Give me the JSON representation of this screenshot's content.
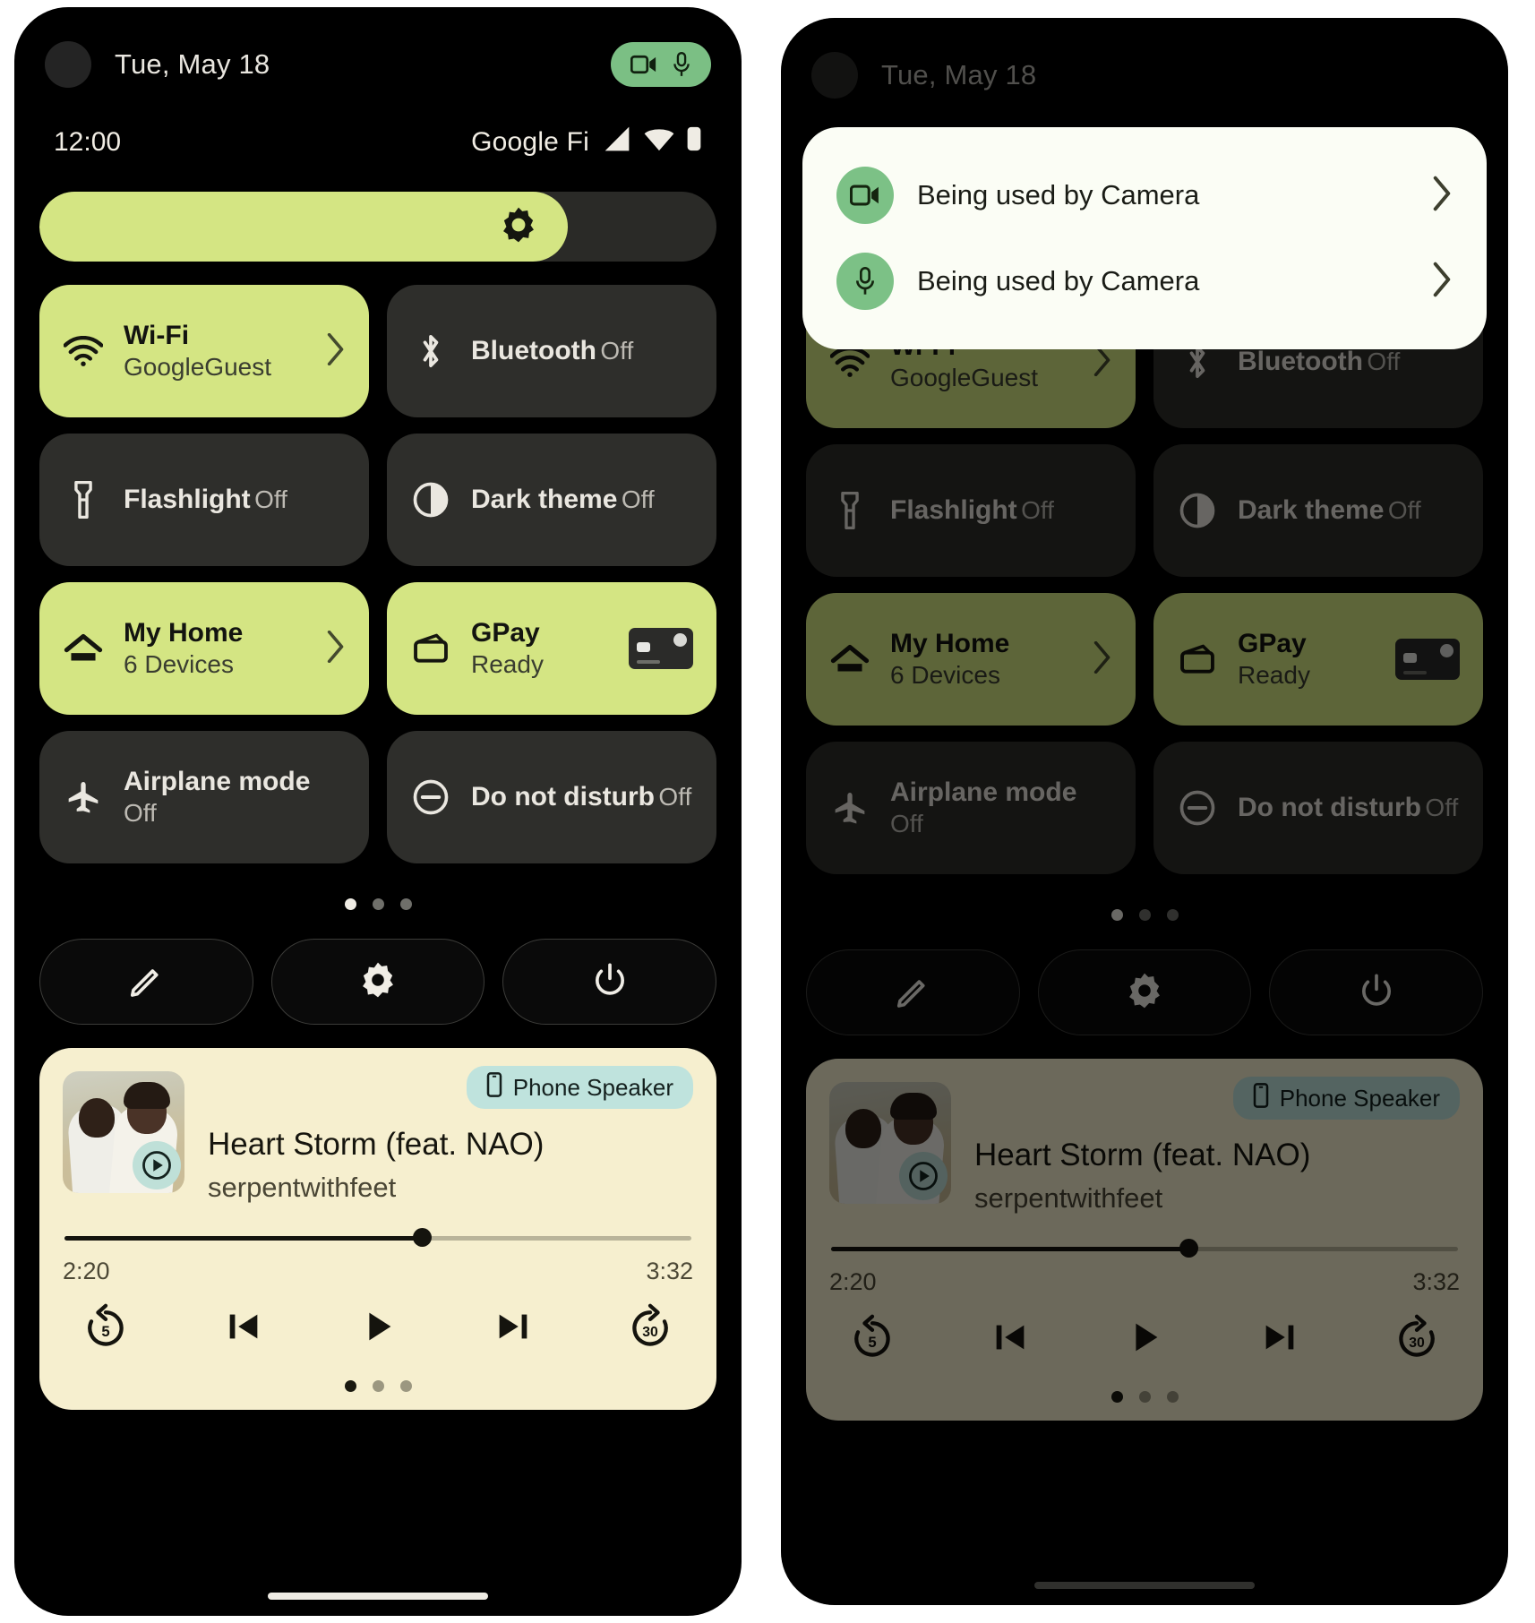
{
  "colors": {
    "accent_active_tile": "#d4e583",
    "tile_inactive": "#2e2e2b",
    "privacy_green": "#7bbf84",
    "media_bg": "#f6efcf",
    "speaker_chip": "#bfe3dd",
    "screen_bg": "#000000"
  },
  "status": {
    "date": "Tue, May 18",
    "time": "12:00",
    "carrier": "Google Fi",
    "privacy_icons": [
      "camera-icon",
      "microphone-icon"
    ],
    "signal_icon": "cell-signal-icon",
    "wifi_icon": "wifi-icon",
    "battery_icon": "battery-icon"
  },
  "brightness": {
    "icon": "brightness-icon",
    "level_percent": 78
  },
  "tiles": [
    {
      "name": "Wi-Fi",
      "sub": "GoogleGuest",
      "icon": "wifi-icon",
      "active": true,
      "chevron": true,
      "thumb": false
    },
    {
      "name": "Bluetooth",
      "sub": "Off",
      "icon": "bluetooth-icon",
      "active": false,
      "chevron": false,
      "thumb": false
    },
    {
      "name": "Flashlight",
      "sub": "Off",
      "icon": "flashlight-icon",
      "active": false,
      "chevron": false,
      "thumb": false
    },
    {
      "name": "Dark theme",
      "sub": "Off",
      "icon": "dark-theme-icon",
      "active": false,
      "chevron": false,
      "thumb": false
    },
    {
      "name": "My Home",
      "sub": "6 Devices",
      "icon": "home-icon",
      "active": true,
      "chevron": true,
      "thumb": false
    },
    {
      "name": "GPay",
      "sub": "Ready",
      "icon": "wallet-icon",
      "active": true,
      "chevron": false,
      "thumb": true
    },
    {
      "name": "Airplane mode",
      "sub": "Off",
      "icon": "airplane-icon",
      "active": false,
      "chevron": false,
      "thumb": false
    },
    {
      "name": "Do not disturb",
      "sub": "Off",
      "icon": "do-not-disturb-icon",
      "active": false,
      "chevron": false,
      "thumb": false
    }
  ],
  "pager": {
    "count": 3,
    "active_index": 0
  },
  "footer_actions": [
    {
      "name": "edit-tiles",
      "icon": "pencil-icon"
    },
    {
      "name": "settings",
      "icon": "gear-icon"
    },
    {
      "name": "power",
      "icon": "power-icon"
    }
  ],
  "media": {
    "output_label": "Phone Speaker",
    "output_icon": "phone-icon",
    "title": "Heart Storm (feat. NAO)",
    "artist": "serpentwithfeet",
    "elapsed": "2:20",
    "duration": "3:32",
    "progress_percent": 57,
    "art_badge_icon": "play-circle-icon",
    "controls": [
      {
        "name": "rewind-5-button",
        "icon": "replay-5-icon",
        "label": "5"
      },
      {
        "name": "previous-button",
        "icon": "skip-previous-icon",
        "label": ""
      },
      {
        "name": "play-button",
        "icon": "play-icon",
        "label": ""
      },
      {
        "name": "next-button",
        "icon": "skip-next-icon",
        "label": ""
      },
      {
        "name": "forward-30-button",
        "icon": "forward-30-icon",
        "label": "30"
      }
    ],
    "pager": {
      "count": 3,
      "active_index": 0
    }
  },
  "privacy_dialog": {
    "rows": [
      {
        "icon": "camera-icon",
        "text": "Being used by Camera"
      },
      {
        "icon": "microphone-icon",
        "text": "Being used by Camera"
      }
    ],
    "chevron_icon": "chevron-right-icon"
  }
}
